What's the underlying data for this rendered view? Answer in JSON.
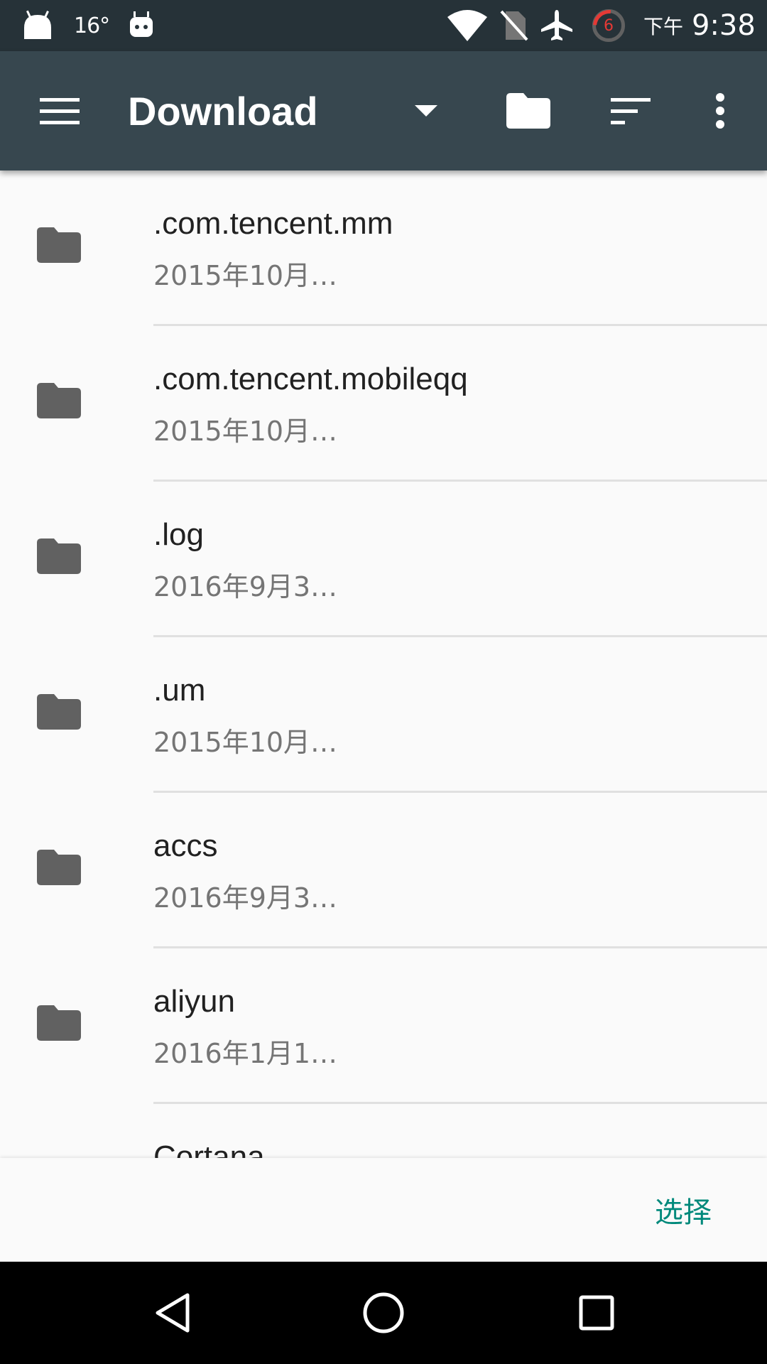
{
  "status_bar": {
    "temperature": "16°",
    "notification_count": "6",
    "ampm": "下午",
    "time": "9:38"
  },
  "toolbar": {
    "title": "Download"
  },
  "files": [
    {
      "name": ".com.tencent.mm",
      "date": "2015年10月…"
    },
    {
      "name": ".com.tencent.mobileqq",
      "date": "2015年10月…"
    },
    {
      "name": ".log",
      "date": "2016年9月3…"
    },
    {
      "name": ".um",
      "date": "2015年10月…"
    },
    {
      "name": "accs",
      "date": "2016年9月3…"
    },
    {
      "name": "aliyun",
      "date": "2016年1月1…"
    },
    {
      "name": "Cortana",
      "date": ""
    }
  ],
  "action_bar": {
    "select_label": "选择"
  },
  "colors": {
    "status_bar": "#263238",
    "toolbar": "#37474f",
    "accent": "#00897b",
    "folder": "#616161"
  },
  "icons": [
    "android-icon",
    "robot-icon",
    "wifi-icon",
    "no-sim-icon",
    "airplane-icon",
    "menu-icon",
    "dropdown-icon",
    "new-folder-icon",
    "sort-icon",
    "more-vert-icon",
    "folder-icon",
    "back-icon",
    "home-icon",
    "recents-icon"
  ]
}
